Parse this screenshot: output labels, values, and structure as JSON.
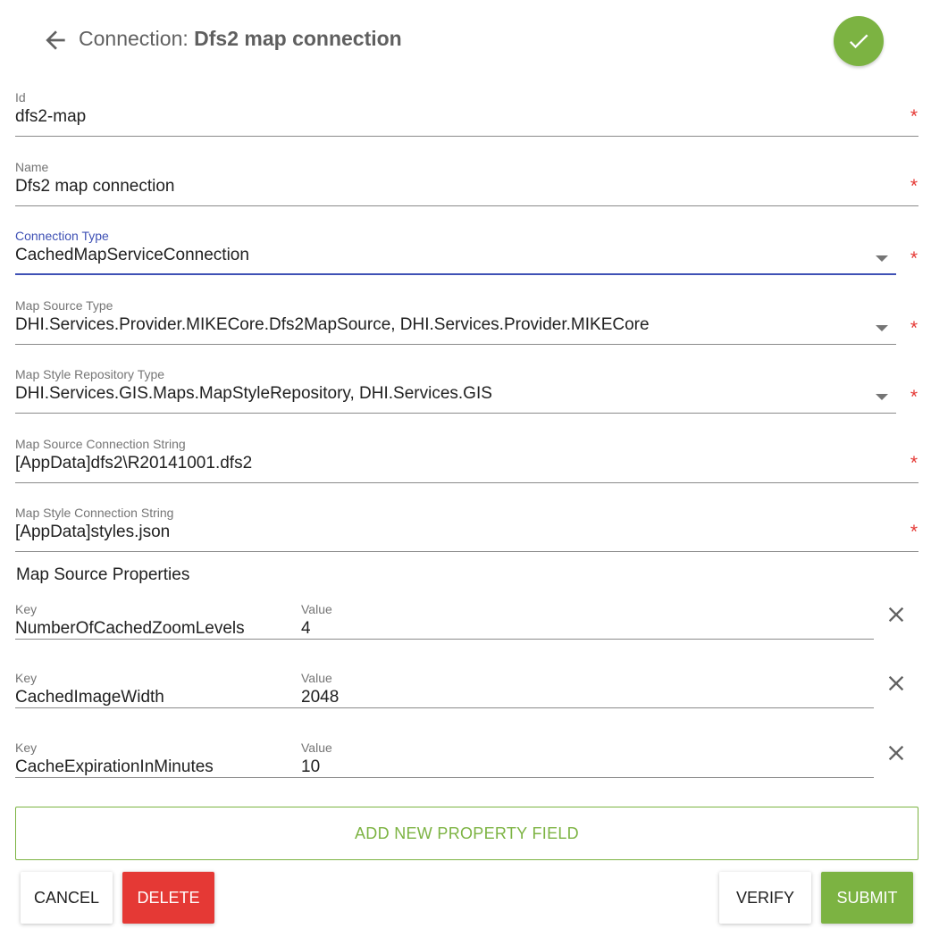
{
  "header": {
    "title_prefix": "Connection: ",
    "title_name": "Dfs2 map connection"
  },
  "fields": [
    {
      "label": "Id",
      "value": "dfs2-map",
      "required": "*"
    },
    {
      "label": "Name",
      "value": "Dfs2 map connection",
      "required": "*"
    },
    {
      "label": "Connection Type",
      "value": "CachedMapServiceConnection",
      "required": "*"
    },
    {
      "label": "Map Source Type",
      "value": "DHI.Services.Provider.MIKECore.Dfs2MapSource, DHI.Services.Provider.MIKECore",
      "required": "*"
    },
    {
      "label": "Map Style Repository Type",
      "value": "DHI.Services.GIS.Maps.MapStyleRepository, DHI.Services.GIS",
      "required": "*"
    },
    {
      "label": "Map Source Connection String",
      "value": "[AppData]dfs2\\R20141001.dfs2",
      "required": "*"
    },
    {
      "label": "Map Style Connection String",
      "value": "[AppData]styles.json",
      "required": "*"
    }
  ],
  "properties": {
    "section_title": "Map Source Properties",
    "key_label": "Key",
    "value_label": "Value",
    "rows": [
      {
        "key": "NumberOfCachedZoomLevels",
        "value": "4"
      },
      {
        "key": "CachedImageWidth",
        "value": "2048"
      },
      {
        "key": "CacheExpirationInMinutes",
        "value": "10"
      }
    ],
    "add_label": "ADD NEW PROPERTY FIELD"
  },
  "actions": {
    "cancel": "CANCEL",
    "delete": "DELETE",
    "verify": "VERIFY",
    "submit": "SUBMIT"
  },
  "colors": {
    "accent_green": "#7cb342",
    "focus_blue": "#3f51b5",
    "danger_red": "#e53935"
  }
}
